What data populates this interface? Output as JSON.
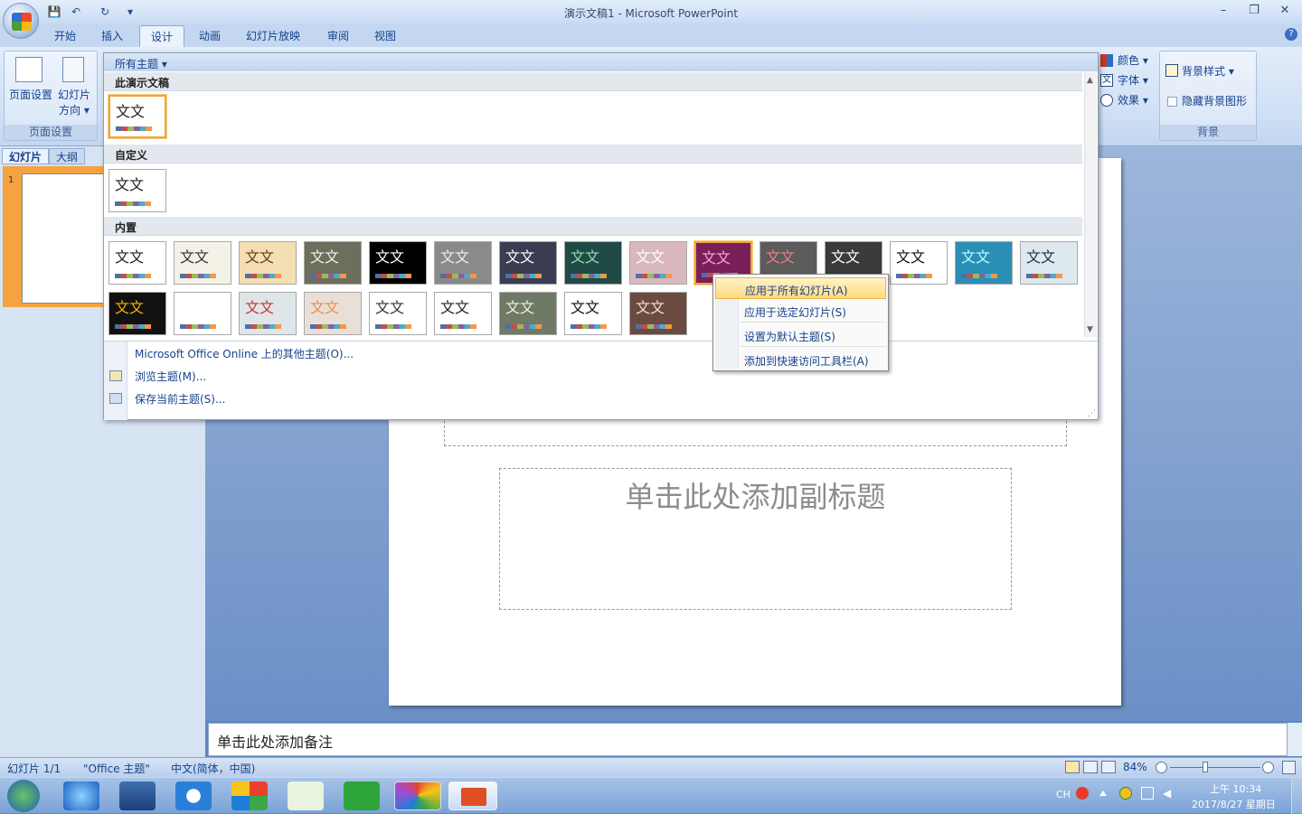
{
  "window": {
    "title": "演示文稿1 - Microsoft PowerPoint",
    "minimize": "–",
    "restore": "❐",
    "close": "✕"
  },
  "qat": {
    "save": "💾",
    "undo": "↶",
    "redo": "↻",
    "more": "▾"
  },
  "tabs": [
    "开始",
    "插入",
    "设计",
    "动画",
    "幻灯片放映",
    "审阅",
    "视图"
  ],
  "active_tab": "设计",
  "help": "?",
  "ribbon": {
    "page_setup_group": {
      "label": "页面设置",
      "page_setup": "页面设置",
      "orientation": "幻灯片",
      "orientation2": "方向 ▾"
    },
    "theme_options": {
      "colors": "颜色 ▾",
      "fonts": "字体 ▾",
      "effects": "效果 ▾"
    },
    "background_group": {
      "label": "背景",
      "styles": "背景样式 ▾",
      "hide_graphics": "隐藏背景图形"
    }
  },
  "gallery": {
    "header": "所有主题 ▾",
    "sections": {
      "this_presentation": "此演示文稿",
      "custom": "自定义",
      "builtin": "内置"
    },
    "sample_text": "文文",
    "footer": {
      "online": "Microsoft Office Online 上的其他主题(O)...",
      "browse": "浏览主题(M)...",
      "save": "保存当前主题(S)..."
    }
  },
  "context_menu": {
    "items": [
      "应用于所有幻灯片(A)",
      "应用于选定幻灯片(S)",
      "设置为默认主题(S)",
      "添加到快速访问工具栏(A)"
    ],
    "highlighted_index": 0
  },
  "left_pane": {
    "tab_slides": "幻灯片",
    "tab_outline": "大纲",
    "slide_number": "1"
  },
  "slide": {
    "subtitle_placeholder": "单击此处添加副标题"
  },
  "notes": {
    "placeholder": "单击此处添加备注"
  },
  "statusbar": {
    "slide_pos": "幻灯片 1/1",
    "theme": "\"Office 主题\"",
    "language": "中文(简体，中国)",
    "zoom": "84%"
  },
  "taskbar": {
    "lang": "CH",
    "time": "上午 10:34",
    "date": "2017/8/27 星期日"
  },
  "colors": {
    "accent_orange": "#f1a33b",
    "ribbon_blue": "#15428b",
    "highlight": "#ffd97e"
  }
}
